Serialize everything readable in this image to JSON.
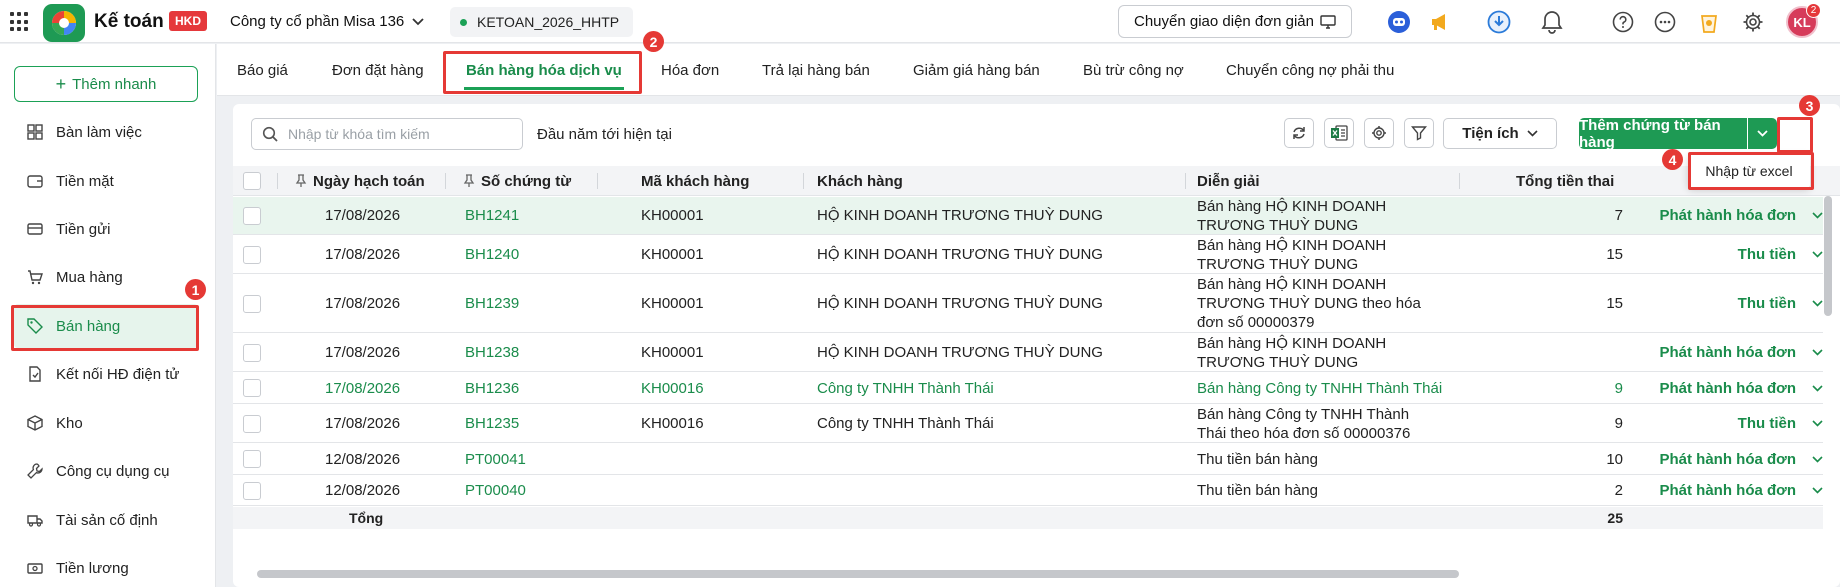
{
  "topbar": {
    "app_name": "Kế toán",
    "badge": "HKD",
    "company": "Công ty cổ phần Misa 136",
    "database": "KETOAN_2026_HHTP",
    "switch_ui_label": "Chuyển giao diện đơn giản",
    "avatar_initials": "KL",
    "notification_count": "2"
  },
  "sidebar": {
    "add_quick_label": "Thêm nhanh",
    "items": [
      {
        "label": "Bàn làm việc",
        "icon": "dashboard-icon"
      },
      {
        "label": "Tiền mặt",
        "icon": "wallet-icon"
      },
      {
        "label": "Tiền gửi",
        "icon": "bank-card-icon"
      },
      {
        "label": "Mua hàng",
        "icon": "cart-icon"
      },
      {
        "label": "Bán hàng",
        "icon": "tag-icon"
      },
      {
        "label": "Kết nối HĐ điện tử",
        "icon": "invoice-icon"
      },
      {
        "label": "Kho",
        "icon": "box-icon"
      },
      {
        "label": "Công cụ dụng cụ",
        "icon": "wrench-icon"
      },
      {
        "label": "Tài sản cố định",
        "icon": "truck-icon"
      },
      {
        "label": "Tiền lương",
        "icon": "money-icon"
      }
    ]
  },
  "tabs": [
    "Báo giá",
    "Đơn đặt hàng",
    "Bán hàng hóa dịch vụ",
    "Hóa đơn",
    "Trả lại hàng bán",
    "Giảm giá hàng bán",
    "Bù trừ công nợ",
    "Chuyển công nợ phải thu"
  ],
  "toolbar": {
    "search_placeholder": "Nhập từ khóa tìm kiếm",
    "period": "Đầu năm tới hiện tại",
    "utils_label": "Tiện ích",
    "add_voucher_label": "Thêm chứng từ bán hàng",
    "dropdown_item": "Nhập từ excel"
  },
  "table": {
    "headers": {
      "date": "Ngày hạch toán",
      "voucher": "Số chứng từ",
      "customer_code": "Mã khách hàng",
      "customer": "Khách hàng",
      "description": "Diễn giải",
      "total": "Tổng tiền thai"
    },
    "rows": [
      {
        "date": "17/08/2026",
        "voucher": "BH1241",
        "code": "KH00001",
        "customer": "HỘ KINH DOANH TRƯƠNG THUỲ DUNG",
        "desc": "Bán hàng HỘ KINH DOANH TRƯƠNG THUỲ DUNG",
        "total": "7",
        "action": "Phát hành hóa đơn"
      },
      {
        "date": "17/08/2026",
        "voucher": "BH1240",
        "code": "KH00001",
        "customer": "HỘ KINH DOANH TRƯƠNG THUỲ DUNG",
        "desc": "Bán hàng HỘ KINH DOANH TRƯƠNG THUỲ DUNG",
        "total": "15",
        "action": "Thu tiền"
      },
      {
        "date": "17/08/2026",
        "voucher": "BH1239",
        "code": "KH00001",
        "customer": "HỘ KINH DOANH TRƯƠNG THUỲ DUNG",
        "desc": "Bán hàng HỘ KINH DOANH TRƯƠNG THUỲ DUNG theo hóa đơn số 00000379",
        "total": "15",
        "action": "Thu tiền"
      },
      {
        "date": "17/08/2026",
        "voucher": "BH1238",
        "code": "KH00001",
        "customer": "HỘ KINH DOANH TRƯƠNG THUỲ DUNG",
        "desc": "Bán hàng HỘ KINH DOANH TRƯƠNG THUỲ DUNG",
        "total": "",
        "action": "Phát hành hóa đơn"
      },
      {
        "date": "17/08/2026",
        "voucher": "BH1236",
        "code": "KH00016",
        "customer": "Công ty TNHH Thành Thái",
        "desc": "Bán hàng Công ty TNHH Thành Thái",
        "total": "9",
        "action": "Phát hành hóa đơn"
      },
      {
        "date": "17/08/2026",
        "voucher": "BH1235",
        "code": "KH00016",
        "customer": "Công ty TNHH Thành Thái",
        "desc": "Bán hàng Công ty TNHH Thành Thái theo hóa đơn số 00000376",
        "total": "9",
        "action": "Thu tiền"
      },
      {
        "date": "12/08/2026",
        "voucher": "PT00041",
        "code": "",
        "customer": "",
        "desc": "Thu tiền bán hàng",
        "total": "10",
        "action": "Phát hành hóa đơn"
      },
      {
        "date": "12/08/2026",
        "voucher": "PT00040",
        "code": "",
        "customer": "",
        "desc": "Thu tiền bán hàng",
        "total": "2",
        "action": "Phát hành hóa đơn"
      }
    ],
    "total_label": "Tổng",
    "total_value": "25"
  },
  "annotations": [
    "1",
    "2",
    "3",
    "4"
  ],
  "colors": {
    "brand_green": "#1e9a54",
    "annotation_red": "#e53935",
    "hkd_red": "#e5383b"
  }
}
